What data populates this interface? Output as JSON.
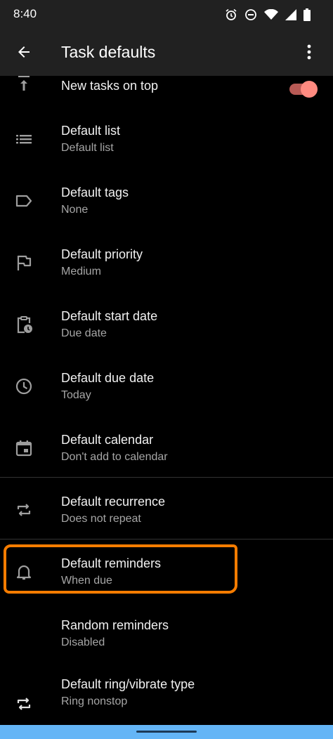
{
  "status": {
    "time": "8:40"
  },
  "header": {
    "title": "Task defaults"
  },
  "items": [
    {
      "title": "New tasks on top",
      "summary": ""
    },
    {
      "title": "Default list",
      "summary": "Default list"
    },
    {
      "title": "Default tags",
      "summary": "None"
    },
    {
      "title": "Default priority",
      "summary": "Medium"
    },
    {
      "title": "Default start date",
      "summary": "Due date"
    },
    {
      "title": "Default due date",
      "summary": "Today"
    },
    {
      "title": "Default calendar",
      "summary": "Don't add to calendar"
    },
    {
      "title": "Default recurrence",
      "summary": "Does not repeat"
    },
    {
      "title": "Default reminders",
      "summary": "When due"
    },
    {
      "title": "Random reminders",
      "summary": "Disabled"
    },
    {
      "title": "Default ring/vibrate type",
      "summary": "Ring nonstop"
    }
  ],
  "toggle": {
    "checked": true
  },
  "colors": {
    "accent": "#ff8a80",
    "highlight": "#f57c00",
    "appbar": "#212121",
    "navbar": "#64b5f6"
  }
}
